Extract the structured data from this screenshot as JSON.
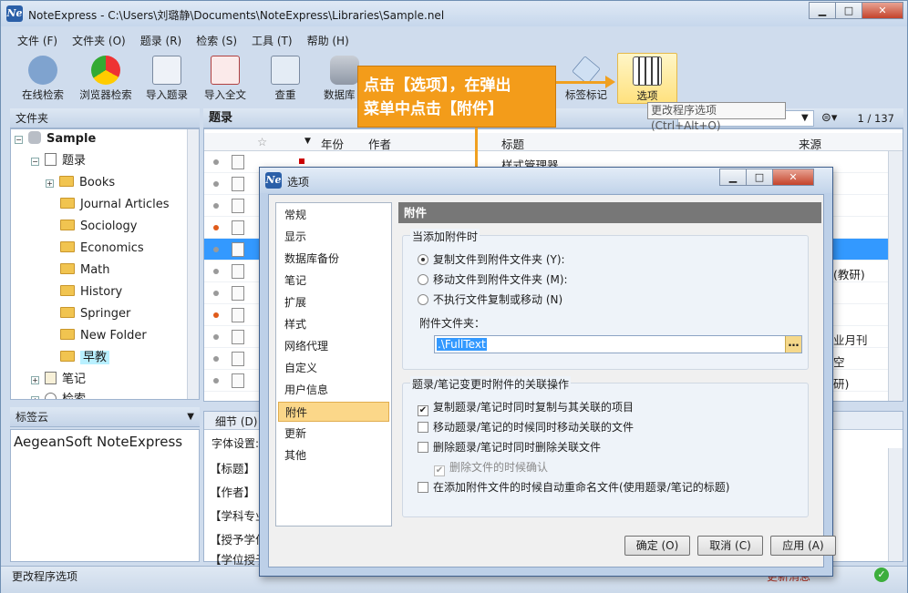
{
  "window": {
    "title": "NoteExpress - C:\\Users\\刘璐静\\Documents\\NoteExpress\\Libraries\\Sample.nel",
    "logo_text": "Ne"
  },
  "menu": [
    "文件 (F)",
    "文件夹 (O)",
    "题录 (R)",
    "检索 (S)",
    "工具 (T)",
    "帮助 (H)"
  ],
  "toolbar": {
    "online_search": "在线检索",
    "browser_search": "浏览器检索",
    "import_refs": "导入题录",
    "import_fulltext": "导入全文",
    "dedupe": "查重",
    "database": "数据库",
    "tag_mark": "标签标记",
    "options": "选项"
  },
  "callout": {
    "line1": "点击【选项】，在弹出",
    "line2": "菜单中点击【附件】"
  },
  "tooltip": "更改程序选项 (Ctrl+Alt+O)",
  "folders": {
    "header": "文件夹",
    "root": "Sample",
    "refs": "题录",
    "items": [
      "Books",
      "Journal Articles",
      "Sociology",
      "Economics",
      "Math",
      "History",
      "Springer",
      "New Folder",
      "早教"
    ],
    "notes": "笔记",
    "search": "检索"
  },
  "tagcloud": {
    "header": "标签云",
    "content": "AegeanSoft  NoteExpress"
  },
  "refs": {
    "header": "题录",
    "count": "1 / 137",
    "cols": {
      "year": "年份",
      "author": "作者",
      "title": "标题",
      "source": "来源"
    },
    "first_title": "样式管理器",
    "source_frags": [
      "(教研)",
      "业月刊",
      "空",
      "研)"
    ]
  },
  "details": {
    "tab": "细节 (D)",
    "font_setting": "字体设置:",
    "fields": [
      "【标题】",
      "【作者】",
      "【学科专业",
      "【授予学位",
      "【学位授予"
    ]
  },
  "status": {
    "text": "更改程序选项",
    "right": "更新消息"
  },
  "dialog": {
    "title": "选项",
    "nav": [
      "常规",
      "显示",
      "数据库备份",
      "笔记",
      "扩展",
      "样式",
      "网络代理",
      "自定义",
      "用户信息",
      "附件",
      "更新",
      "其他"
    ],
    "section": "附件",
    "group1": {
      "legend": "当添加附件时",
      "opt1": "复制文件到附件文件夹 (Y):",
      "opt2": "移动文件到附件文件夹 (M):",
      "opt3": "不执行文件复制或移动 (N)",
      "folder_label": "附件文件夹：",
      "folder_value": ".\\FullText"
    },
    "group2": {
      "legend": "题录/笔记变更时附件的关联操作",
      "c1": "复制题录/笔记时同时复制与其关联的项目",
      "c2": "移动题录/笔记的时候同时移动关联的文件",
      "c3": "删除题录/笔记时同时删除关联文件",
      "c4": "删除文件的时候确认",
      "c5": "在添加附件文件的时候自动重命名文件(使用题录/笔记的标题)"
    },
    "ok": "确定 (O)",
    "cancel": "取消 (C)",
    "apply": "应用 (A)"
  }
}
